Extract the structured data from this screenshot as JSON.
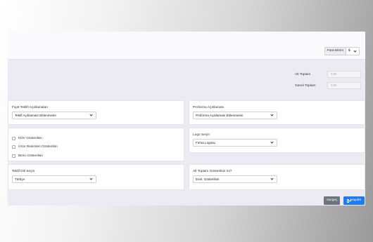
{
  "header": {
    "currency_label": "Para Birimi",
    "currency_value": "₺"
  },
  "totals": {
    "subtotal_label": "Alt Toplam",
    "subtotal_value": "0.00",
    "grand_total_label": "Genel Toplam",
    "grand_total_value": "0.00"
  },
  "offer_description": {
    "label": "Fiyat Teklifi Açıklamaları",
    "value": "Teklif Açıklaması Eklenmesin"
  },
  "proforma_description": {
    "label": "Proforma Açıklaması",
    "value": "Proforma Açıklaması Eklenmesin"
  },
  "options": {
    "show_vat": "KDV Gösterilsin",
    "show_product_images": "Ürün Resimleri Gösterilsin",
    "show_unit": "Birim Gösterilsin"
  },
  "logo": {
    "label": "Logo Seçin",
    "value": "Firma Logosu"
  },
  "language": {
    "label": "Teklif Dili Seçin",
    "value": "Türkçe"
  },
  "subtotal_visibility": {
    "label": "Alt Toplam Gösterilsin mi?",
    "value": "Evet, Gösterilsin"
  },
  "actions": {
    "cancel": "Vazgeç",
    "save": "Kaydet"
  }
}
